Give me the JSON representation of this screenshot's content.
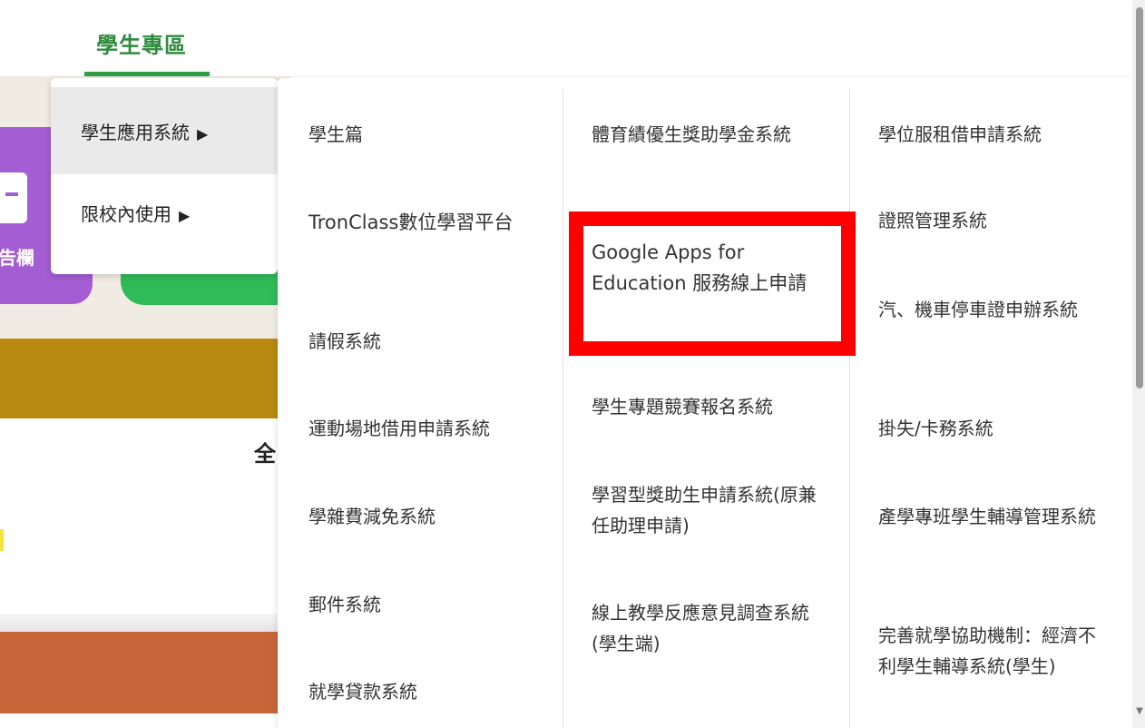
{
  "nav": {
    "title": "學生專區"
  },
  "background": {
    "purple_card_text": "告欄",
    "heading_fragment": "全"
  },
  "menu_level1": [
    {
      "label": "學生應用系統",
      "arrow": "▶",
      "active": true
    },
    {
      "label": "限校內使用",
      "arrow": "▶",
      "active": false
    }
  ],
  "menu_level2": {
    "col1": [
      "學生篇",
      "TronClass數位學習平台",
      "請假系統",
      "運動場地借用申請系統",
      "學雜費減免系統",
      "郵件系統",
      "就學貸款系統"
    ],
    "col2": [
      "體育績優生獎助學金系統",
      "Google Apps for Education 服務線上申請",
      "學生專題競賽報名系統",
      "學習型獎助生申請系統(原兼任助理申請)",
      "線上教學反應意見調查系統(學生端)"
    ],
    "col3": [
      "學位服租借申請系統",
      "證照管理系統",
      "汽、機車停車證申辦系統",
      "掛失/卡務系統",
      "產學專班學生輔導管理系統",
      "完善就學協助機制：經濟不利學生輔導系統(學生)"
    ]
  },
  "highlighted_item": "Google Apps for Education 服務線上申請",
  "colors": {
    "brand_green": "#2e9e44",
    "highlight_red": "#ff0000",
    "purple": "#a45dd3",
    "ochre": "#b98a10",
    "orange": "#c76638"
  },
  "icons": {
    "submenu_arrow": "triangle-right-icon",
    "scroll_down": "triangle-down-icon"
  }
}
